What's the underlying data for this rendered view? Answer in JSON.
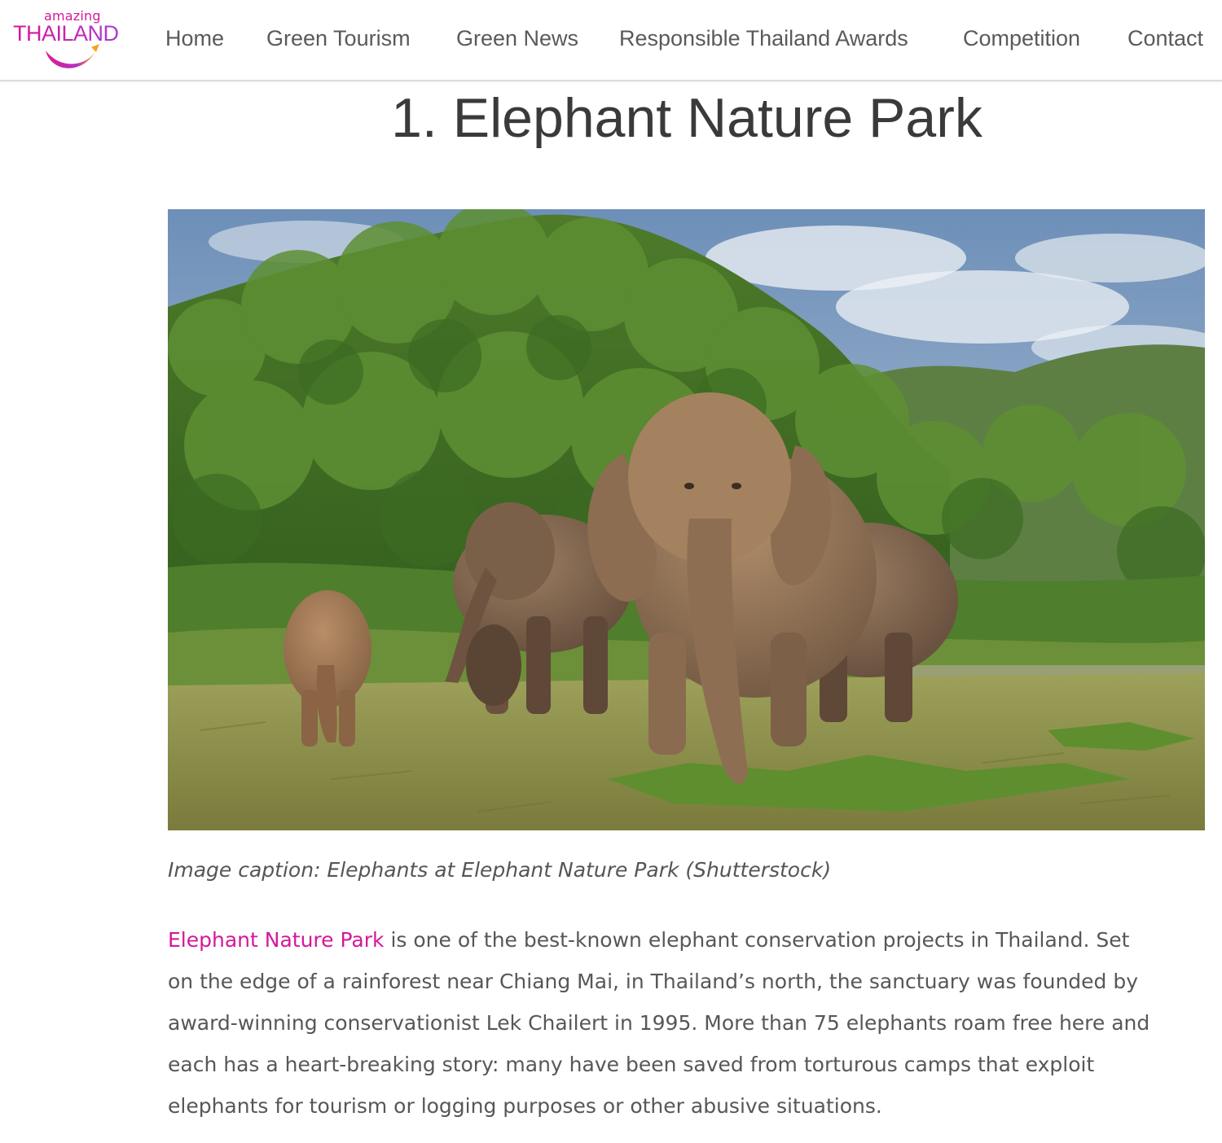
{
  "brand": {
    "logo_small": "amazing",
    "logo_big": "THAILAND",
    "pink": "#d4189a",
    "purple": "#a63fd0"
  },
  "nav": {
    "items": [
      {
        "label": "Home"
      },
      {
        "label": "Green Tourism"
      },
      {
        "label": "Green News"
      },
      {
        "label": "Responsible Thailand Awards"
      },
      {
        "label": "Competition"
      },
      {
        "label": "Contact"
      }
    ]
  },
  "article": {
    "title": "1. Elephant Nature Park",
    "caption": "Image caption: Elephants at Elephant Nature Park (Shutterstock)",
    "link_text": "Elephant Nature Park",
    "lines": [
      " is one of the best-known elephant conservation projects in Thailand. Set",
      "on the edge of a rainforest near Chiang Mai, in Thailand’s north, the sanctuary was founded by",
      "award-winning conservationist Lek Chailert in 1995. More than 75 elephants roam free here and",
      "each has a heart-breaking story: many have been saved from torturous camps that exploit",
      "elephants for tourism or logging purposes or other abusive situations."
    ]
  }
}
